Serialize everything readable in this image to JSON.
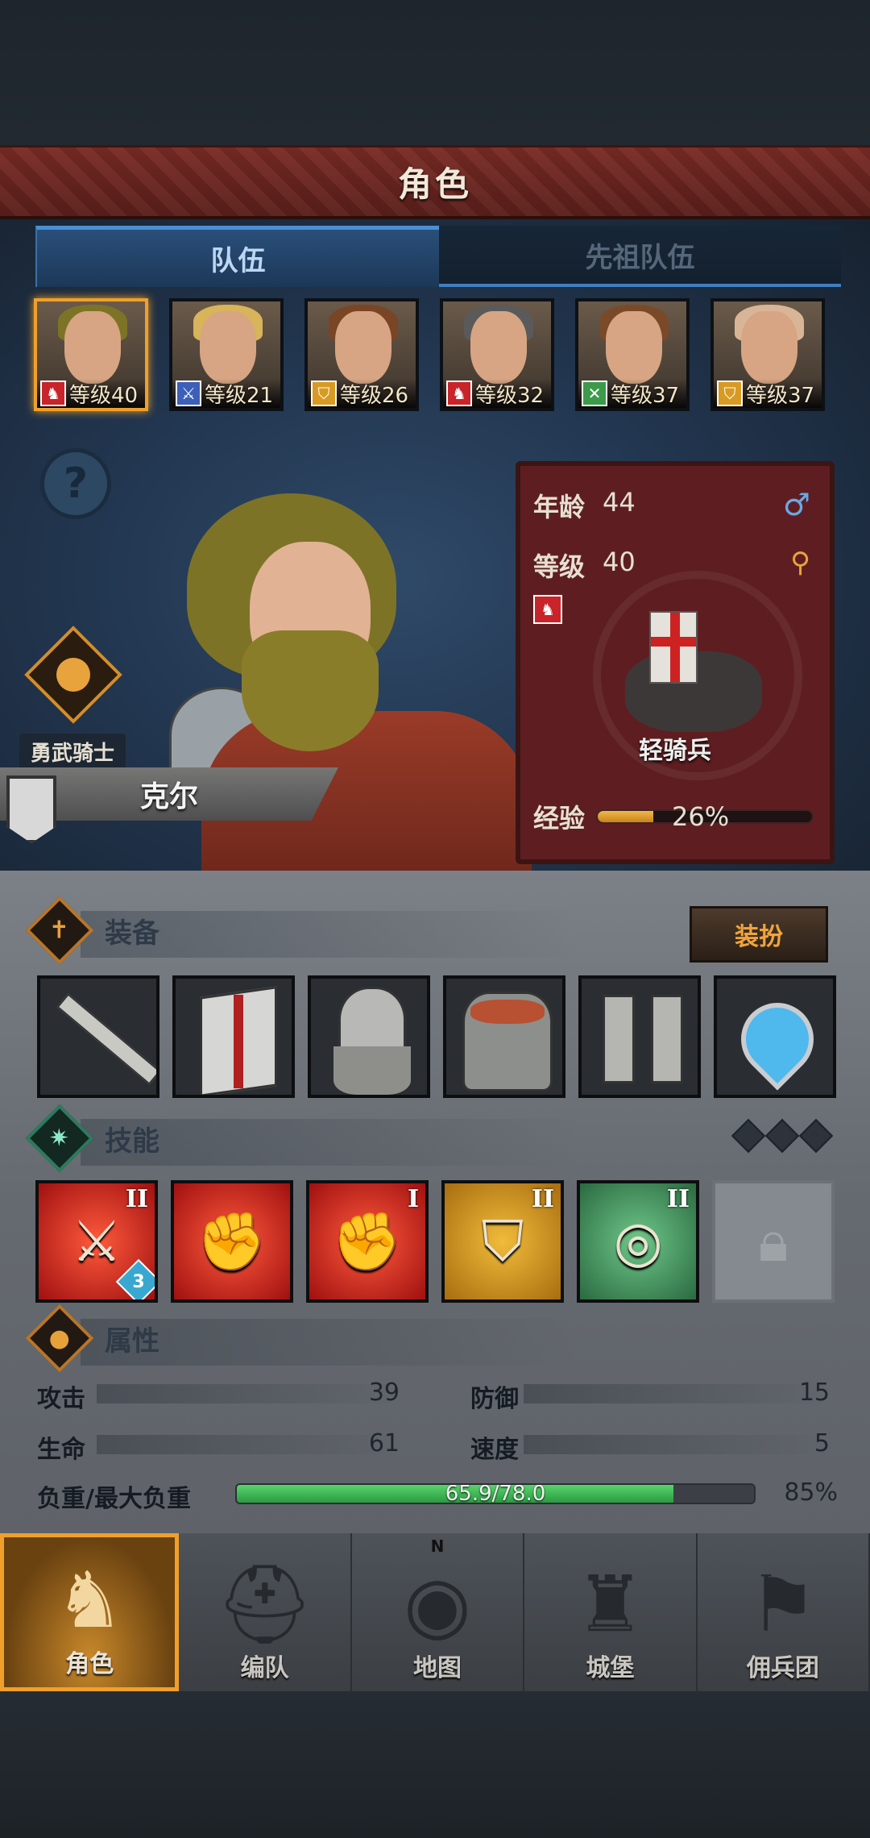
{
  "header": {
    "title": "角色"
  },
  "tabs": [
    {
      "label": "队伍",
      "active": true
    },
    {
      "label": "先祖队伍",
      "active": false
    }
  ],
  "roster": [
    {
      "class_icon": "horse-icon",
      "class_color": "#c8242a",
      "level_text": "等级40",
      "hair": "#7d7326",
      "selected": true
    },
    {
      "class_icon": "sword-icon",
      "class_color": "#3c5fb8",
      "level_text": "等级21",
      "hair": "#d8b45a",
      "selected": false
    },
    {
      "class_icon": "shield-icon",
      "class_color": "#d89a22",
      "level_text": "等级26",
      "hair": "#7a4524",
      "selected": false
    },
    {
      "class_icon": "horse-icon",
      "class_color": "#c8242a",
      "level_text": "等级32",
      "hair": "#5a5a5a",
      "selected": false
    },
    {
      "class_icon": "crossed-swords-icon",
      "class_color": "#3c9a4a",
      "level_text": "等级37",
      "hair": "#7a4a28",
      "selected": false
    },
    {
      "class_icon": "shield-icon",
      "class_color": "#d89a22",
      "level_text": "等级37",
      "hair": "#d9b598",
      "selected": false
    }
  ],
  "hero": {
    "rank": "勇武骑士",
    "name": "克尔",
    "age_label": "年龄",
    "age": "44",
    "level_label": "等级",
    "level": "40",
    "gender_icon": "male-icon",
    "unit_type": "轻骑兵",
    "xp_label": "经验",
    "xp_percent": "26%",
    "xp_fraction": 0.26
  },
  "equipment": {
    "title": "装备",
    "dress_button": "装扮",
    "slots": [
      "sword-slot",
      "shield-slot",
      "helmet-slot",
      "armor-slot",
      "boots-slot",
      "amulet-slot"
    ]
  },
  "skills": {
    "title": "技能",
    "items": [
      {
        "icon": "sword-cursor-icon",
        "rank": "II",
        "badge": "3",
        "color": "red"
      },
      {
        "icon": "broken-fist-icon",
        "rank": "",
        "badge": "",
        "color": "red"
      },
      {
        "icon": "broken-fist-cursor-icon",
        "rank": "I",
        "badge": "",
        "color": "red"
      },
      {
        "icon": "shield-icon",
        "rank": "II",
        "badge": "",
        "color": "gold"
      },
      {
        "icon": "target-icon",
        "rank": "II",
        "badge": "",
        "color": "green"
      },
      {
        "icon": "lock-icon",
        "rank": "",
        "badge": "",
        "color": "locked"
      }
    ]
  },
  "attributes": {
    "title": "属性",
    "attack_label": "攻击",
    "attack": "39",
    "defense_label": "防御",
    "defense": "15",
    "hp_label": "生命",
    "hp": "61",
    "speed_label": "速度",
    "speed": "5",
    "load_label": "负重/最大负重",
    "load_text": "65.9/78.0",
    "load_percent": "85%",
    "load_fraction": 0.845
  },
  "nav": [
    {
      "label": "角色",
      "icon": "knight-icon",
      "active": true
    },
    {
      "label": "编队",
      "icon": "helmet-icon",
      "active": false
    },
    {
      "label": "地图",
      "icon": "compass-map-icon",
      "active": false,
      "marker": "N"
    },
    {
      "label": "城堡",
      "icon": "castle-icon",
      "active": false
    },
    {
      "label": "佣兵团",
      "icon": "banner-icon",
      "active": false
    }
  ]
}
